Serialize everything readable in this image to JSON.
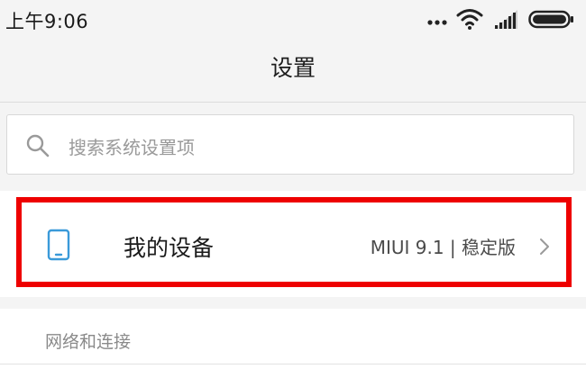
{
  "status_bar": {
    "time": "上午9:06",
    "icons": [
      "more-dots-icon",
      "wifi-icon",
      "signal-icon",
      "battery-icon"
    ]
  },
  "header": {
    "title": "设置"
  },
  "search": {
    "placeholder": "搜索系统设置项",
    "icon": "search-icon"
  },
  "device": {
    "label": "我的设备",
    "version": "MIUI 9.1 | 稳定版",
    "icon": "phone-icon",
    "highlight_color": "#ee0000",
    "accent_color": "#3a9ad9"
  },
  "sections": [
    {
      "header": "网络和连接"
    }
  ]
}
